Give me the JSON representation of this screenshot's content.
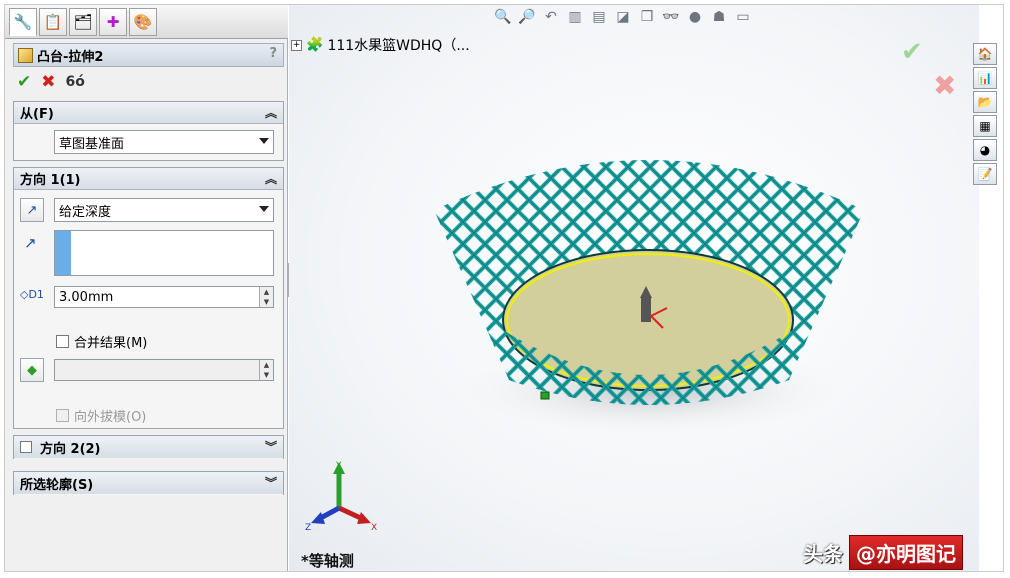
{
  "feature": {
    "title": "凸台-拉伸2",
    "help": "?",
    "actions": {
      "ok": "✔",
      "cancel": "✖",
      "preview": "6ó"
    }
  },
  "from_group": {
    "header": "从(F)",
    "start_condition": "草图基准面"
  },
  "direction1": {
    "header": "方向 1(1)",
    "end_condition": "给定深度",
    "depth": "3.00mm",
    "merge_result_label": "合并结果(M)",
    "merge_result_checked": false,
    "draft_outward_label": "向外拔模(O)"
  },
  "direction2": {
    "header": "方向 2(2)"
  },
  "selected_contours": {
    "header": "所选轮廓(S)"
  },
  "viewport": {
    "tree_root": "111水果篮WDHQ（...",
    "view_name": "*等轴测",
    "triad": {
      "x": "X",
      "y": "Y",
      "z": "Z"
    }
  },
  "watermark": {
    "prefix": "头条",
    "name": "@亦明图记"
  },
  "colors": {
    "basket_mesh": "#1ea3a3",
    "basket_base": "#d2cf9c",
    "rim_highlight": "#f0f000",
    "ok_green": "#2a9d22",
    "cancel_red": "#d22020"
  },
  "icons": {
    "panel_tabs": [
      "feature-manager-icon",
      "property-manager-icon",
      "configuration-manager-icon",
      "dimxpert-icon",
      "display-manager-icon"
    ],
    "task_pane": [
      "home-icon",
      "resources-icon",
      "file-explorer-icon",
      "view-palette-icon",
      "appearances-icon",
      "custom-properties-icon"
    ]
  }
}
